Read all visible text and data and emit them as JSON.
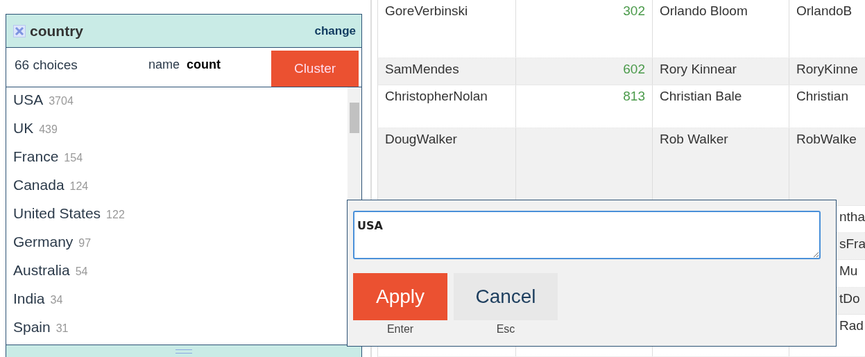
{
  "facet": {
    "title": "country",
    "change_link": "change",
    "choices_count": "66 choices",
    "sort": [
      {
        "label": "name",
        "selected": false
      },
      {
        "label": "count",
        "selected": true
      }
    ],
    "cluster_button": "Cluster",
    "items": [
      {
        "name": "USA",
        "count": "3704"
      },
      {
        "name": "UK",
        "count": "439"
      },
      {
        "name": "France",
        "count": "154"
      },
      {
        "name": "Canada",
        "count": "124"
      },
      {
        "name": "United States",
        "count": "122"
      },
      {
        "name": "Germany",
        "count": "97"
      },
      {
        "name": "Australia",
        "count": "54"
      },
      {
        "name": "India",
        "count": "34"
      },
      {
        "name": "Spain",
        "count": "31"
      }
    ]
  },
  "table": {
    "rows": [
      {
        "cells": [
          "GoreVerbinski",
          "302",
          "Orlando Bloom",
          "OrlandoB"
        ]
      },
      {
        "cells": [
          "SamMendes",
          "602",
          "Rory Kinnear",
          "RoryKinne"
        ]
      },
      {
        "cells": [
          "ChristopherNolan",
          "813",
          "Christian Bale",
          "Christian"
        ]
      },
      {
        "cells": [
          "DougWalker",
          "",
          "Rob Walker",
          "RobWalke"
        ]
      },
      {
        "cells": [
          "",
          "",
          "",
          "ntha"
        ]
      },
      {
        "cells": [
          "",
          "",
          "",
          "sFra"
        ]
      },
      {
        "cells": [
          "",
          "",
          "",
          "Mu"
        ]
      },
      {
        "cells": [
          "",
          "",
          "",
          "tDo"
        ]
      },
      {
        "cells": [
          "",
          "",
          "",
          "Rad"
        ]
      }
    ]
  },
  "edit_popup": {
    "value": "USA",
    "buttons": [
      {
        "label": "Apply",
        "hint": "Enter",
        "kind": "primary"
      },
      {
        "label": "Cancel",
        "hint": "Esc",
        "kind": "secondary"
      }
    ]
  }
}
